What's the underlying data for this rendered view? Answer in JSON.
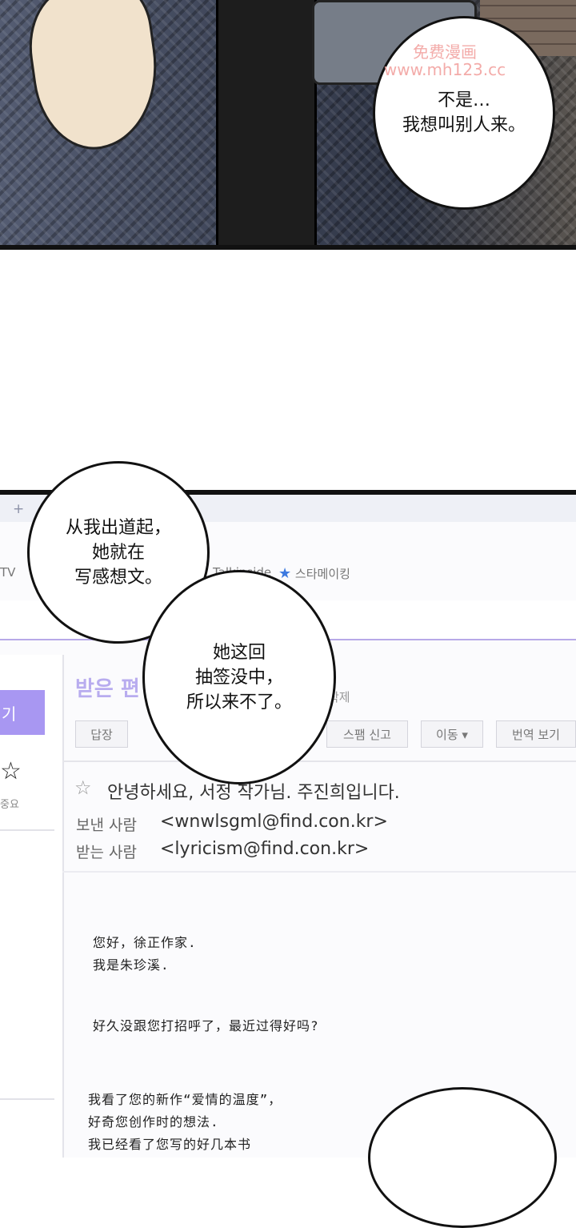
{
  "panel1": {
    "bubble_text": "不是…\n我想叫别人来。",
    "watermark_line1": "免费漫画",
    "watermark_line2": "www.mh123.cc"
  },
  "panel2": {
    "bubble1_text": "从我出道起，\n她就在\n写感想文。",
    "bubble2_text": "她这回\n抽签没中，\n所以来不了。",
    "bubble3_text": "",
    "browser": {
      "tab_plus": "+",
      "bookmark_tv": "TV",
      "bookmark_talkinside": "Talkinside",
      "bookmark_starmaking": "스타메이킹"
    },
    "sidebar": {
      "write_button": "기",
      "important_label": "중요"
    },
    "folder": {
      "title": "받은 편",
      "delete_link": "삭제"
    },
    "toolbar": {
      "reply": "답장",
      "spam": "스팸 신고",
      "move": "이동 ▾",
      "translate": "번역 보기"
    },
    "email": {
      "subject": "안녕하세요, 서정 작가님. 주진희입니다.",
      "sender_label": "보낸 사람",
      "sender_value": "<wnwlsgml@find.con.kr>",
      "recipient_label": "받는 사람",
      "recipient_value": "<lyricism@find.con.kr>",
      "body_lines": [
        "您好，徐正作家.",
        "我是朱珍溪.",
        "好久没跟您打招呼了，最近过得好吗?",
        "我看了您的新作“爱情的温度”，",
        "好奇您创作时的想法.",
        "我已经看了您写的好几本书"
      ]
    }
  }
}
